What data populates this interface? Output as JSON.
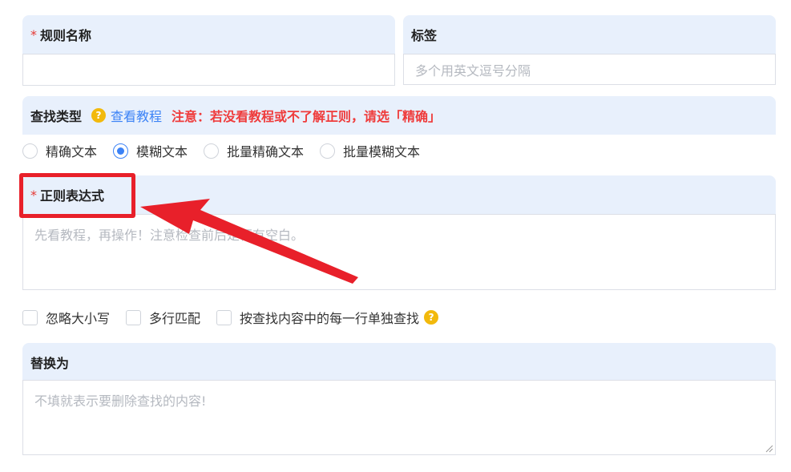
{
  "rule_name": {
    "label": "规则名称",
    "required_mark": "*",
    "value": ""
  },
  "tags": {
    "label": "标签",
    "placeholder": "多个用英文逗号分隔"
  },
  "search_type": {
    "label": "查找类型",
    "help_icon": "question-circle-icon",
    "tutorial_link": "查看教程",
    "warning": "注意：若没看教程或不了解正则，请选「精确」",
    "options": [
      "精确文本",
      "模糊文本",
      "批量精确文本",
      "批量模糊文本"
    ],
    "selected": "模糊文本"
  },
  "regex": {
    "label": "正则表达式",
    "required_mark": "*",
    "placeholder": "先看教程，再操作！注意检查前后是否有空白。"
  },
  "flags": {
    "options": [
      "忽略大小写",
      "多行匹配",
      "按查找内容中的每一行单独查找"
    ],
    "help_icon": "question-circle-icon"
  },
  "replace": {
    "label": "替换为",
    "placeholder": "不填就表示要删除查找的内容!"
  },
  "colors": {
    "accent": "#3b82f6",
    "warning": "#ef3b3b",
    "header_bg": "#e8f0fc",
    "annotation": "#e8202a"
  }
}
